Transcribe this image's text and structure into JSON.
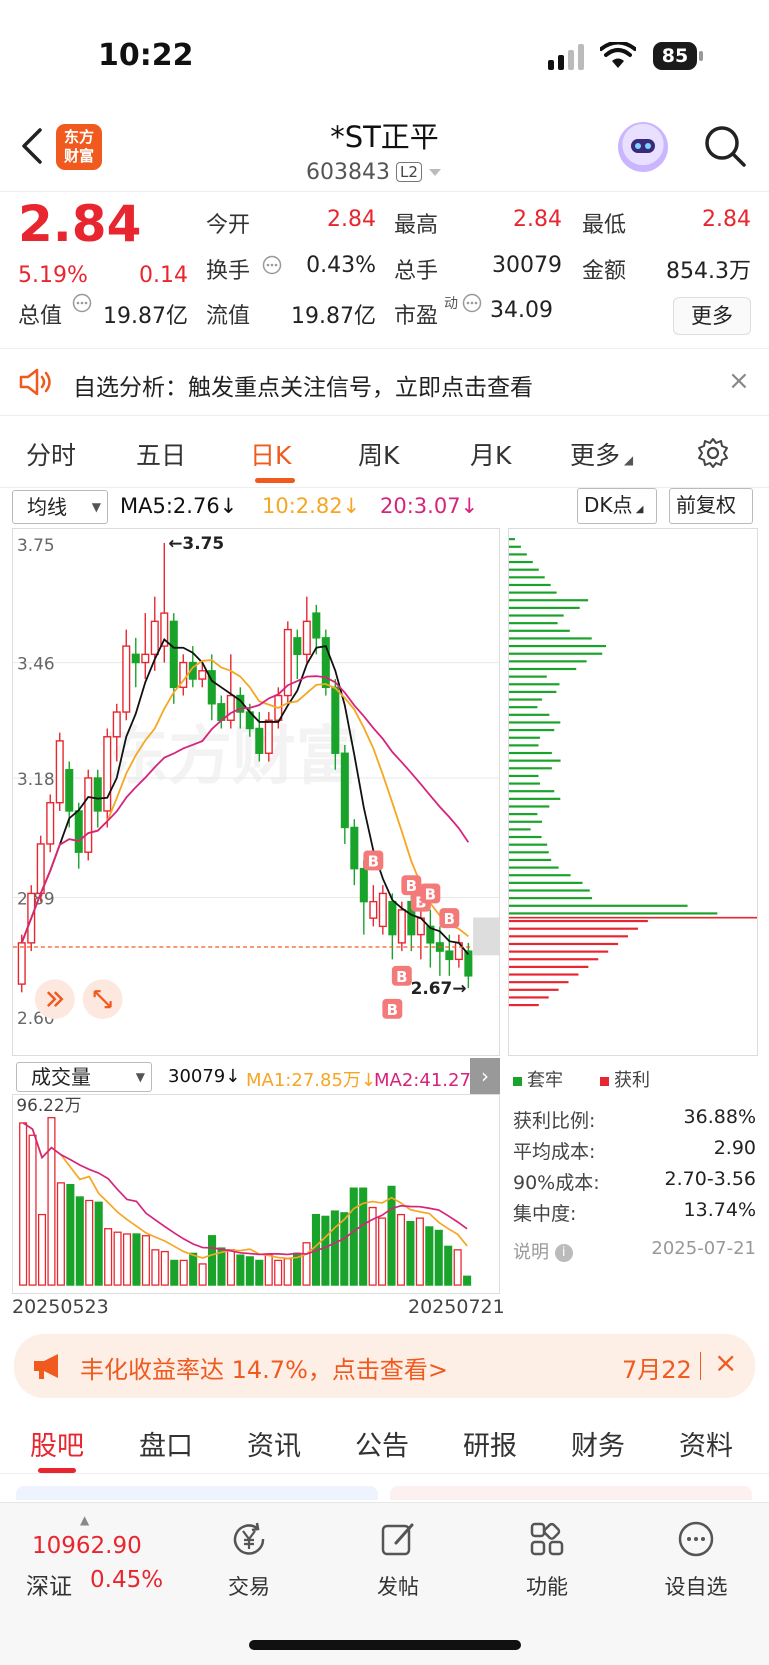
{
  "status_bar": {
    "time": "10:22",
    "battery": "85"
  },
  "header": {
    "title": "*ST正平",
    "code": "603843",
    "level": "L2",
    "logo_text": "东方\n财富"
  },
  "quote": {
    "price": "2.84",
    "change_pct": "5.19%",
    "change": "0.14",
    "rows": [
      [
        {
          "label": "今开",
          "value": "2.84",
          "color": "red"
        },
        {
          "label": "最高",
          "value": "2.84",
          "color": "red"
        },
        {
          "label": "最低",
          "value": "2.84",
          "color": "red"
        }
      ],
      [
        {
          "label": "换手",
          "value": "0.43%",
          "color": "dark"
        },
        {
          "label": "总手",
          "value": "30079",
          "color": "dark"
        },
        {
          "label": "金额",
          "value": "854.3万",
          "color": "dark"
        }
      ]
    ],
    "total_value_label": "总值",
    "total_value": "19.87亿",
    "float_value_label": "流值",
    "float_value": "19.87亿",
    "pe_label": "市盈",
    "pe_sup": "动",
    "pe_value": "34.09",
    "more_button": "更多"
  },
  "banner": {
    "text": "自选分析：触发重点关注信号，立即点击查看",
    "close": "×"
  },
  "period_tabs": [
    {
      "label": "分时"
    },
    {
      "label": "五日"
    },
    {
      "label": "日K",
      "active": true
    },
    {
      "label": "周K"
    },
    {
      "label": "月K"
    },
    {
      "label": "更多"
    }
  ],
  "indicators": {
    "ma_selector": "均线",
    "ma5": "MA5:2.76↓",
    "ma10": "10:2.82↓",
    "ma20": "20:3.07↓",
    "dk_button": "DK点",
    "adjust_button": "前复权",
    "colors": {
      "ma5": "#111111",
      "ma10": "#f5a623",
      "ma20": "#d6247c",
      "up": "#e8262f",
      "down": "#1aa32a"
    }
  },
  "chart_data": {
    "type": "candlestick",
    "y_ticks": [
      "3.75",
      "3.46",
      "3.18",
      "2.89",
      "2.60"
    ],
    "ylim": [
      2.6,
      3.75
    ],
    "high_label": "←3.75",
    "low_label": "2.67→",
    "marker_label": "B",
    "watermark": "东方财富",
    "candles": [
      [
        2.68,
        2.78,
        2.66,
        2.8
      ],
      [
        2.78,
        2.9,
        2.76,
        2.92
      ],
      [
        2.9,
        3.02,
        2.88,
        3.04
      ],
      [
        3.02,
        3.12,
        3.0,
        3.14
      ],
      [
        3.12,
        3.27,
        3.1,
        3.29
      ],
      [
        3.2,
        3.1,
        3.06,
        3.22
      ],
      [
        3.1,
        3.0,
        2.96,
        3.12
      ],
      [
        3.0,
        3.18,
        2.98,
        3.2
      ],
      [
        3.18,
        3.1,
        3.06,
        3.2
      ],
      [
        3.1,
        3.28,
        3.06,
        3.3
      ],
      [
        3.28,
        3.34,
        3.22,
        3.36
      ],
      [
        3.34,
        3.5,
        3.32,
        3.54
      ],
      [
        3.48,
        3.46,
        3.4,
        3.52
      ],
      [
        3.46,
        3.48,
        3.42,
        3.58
      ],
      [
        3.48,
        3.56,
        3.44,
        3.62
      ],
      [
        3.5,
        3.58,
        3.46,
        3.75
      ],
      [
        3.56,
        3.4,
        3.36,
        3.58
      ],
      [
        3.4,
        3.46,
        3.38,
        3.48
      ],
      [
        3.46,
        3.42,
        3.4,
        3.5
      ],
      [
        3.42,
        3.44,
        3.4,
        3.46
      ],
      [
        3.44,
        3.36,
        3.32,
        3.48
      ],
      [
        3.36,
        3.32,
        3.3,
        3.38
      ],
      [
        3.32,
        3.38,
        3.3,
        3.48
      ],
      [
        3.38,
        3.34,
        3.3,
        3.4
      ],
      [
        3.34,
        3.3,
        3.28,
        3.36
      ],
      [
        3.3,
        3.24,
        3.22,
        3.34
      ],
      [
        3.24,
        3.32,
        3.22,
        3.34
      ],
      [
        3.32,
        3.38,
        3.3,
        3.4
      ],
      [
        3.38,
        3.54,
        3.36,
        3.56
      ],
      [
        3.52,
        3.48,
        3.42,
        3.54
      ],
      [
        3.48,
        3.56,
        3.46,
        3.62
      ],
      [
        3.58,
        3.52,
        3.48,
        3.6
      ],
      [
        3.52,
        3.4,
        3.38,
        3.54
      ],
      [
        3.4,
        3.24,
        3.2,
        3.42
      ],
      [
        3.24,
        3.06,
        3.02,
        3.26
      ],
      [
        3.06,
        2.96,
        2.92,
        3.08
      ],
      [
        2.96,
        2.88,
        2.8,
        2.98
      ],
      [
        2.84,
        2.88,
        2.82,
        2.92
      ],
      [
        2.82,
        2.9,
        2.8,
        2.92
      ],
      [
        2.88,
        2.8,
        2.74,
        2.9
      ],
      [
        2.78,
        2.86,
        2.76,
        2.88
      ],
      [
        2.88,
        2.8,
        2.76,
        2.94
      ],
      [
        2.8,
        2.84,
        2.74,
        2.86
      ],
      [
        2.82,
        2.78,
        2.72,
        2.86
      ],
      [
        2.78,
        2.76,
        2.7,
        2.82
      ],
      [
        2.76,
        2.74,
        2.7,
        2.8
      ],
      [
        2.74,
        2.78,
        2.72,
        2.8
      ],
      [
        2.76,
        2.7,
        2.67,
        2.78
      ]
    ],
    "candle_fields": [
      "open",
      "close",
      "low",
      "high"
    ],
    "volume": {
      "selector": "成交量",
      "current": "30079↓",
      "ma1": "MA1:27.85万↓",
      "ma2": "MA2:41.27万",
      "max_label": "96.22万",
      "start_date": "20250523",
      "end_date": "20250721",
      "values": [
        92,
        85,
        40,
        95,
        58,
        57,
        50,
        48,
        47,
        32,
        30,
        29,
        29,
        28,
        20,
        19,
        14,
        14,
        18,
        12,
        28,
        21,
        20,
        17,
        16,
        14,
        17,
        14,
        15,
        18,
        24,
        40,
        39,
        42,
        41,
        55,
        55,
        44,
        38,
        56,
        40,
        36,
        38,
        33,
        31,
        22,
        20,
        5
      ]
    },
    "chip": {
      "legend_profit_locked": "套牢",
      "legend_profit": "获利",
      "stats": [
        {
          "label": "获利比例:",
          "value": "36.88%"
        },
        {
          "label": "平均成本:",
          "value": "2.90"
        },
        {
          "label": "90%成本:",
          "value": "2.70-3.56"
        },
        {
          "label": "集中度:",
          "value": "13.74%"
        }
      ],
      "note_label": "说明",
      "note_date": "2025-07-21"
    }
  },
  "promo": {
    "text": "丰化收益率达 14.7%，点击查看>",
    "date": "7月22",
    "close": "×"
  },
  "content_tabs": [
    "股吧",
    "盘口",
    "资讯",
    "公告",
    "研报",
    "财务",
    "资料"
  ],
  "bottom_bar": {
    "index_value": "10962.90",
    "index_name": "深证",
    "index_pct": "0.45%",
    "items": [
      {
        "label": "交易"
      },
      {
        "label": "发帖"
      },
      {
        "label": "功能"
      },
      {
        "label": "设自选"
      }
    ]
  }
}
